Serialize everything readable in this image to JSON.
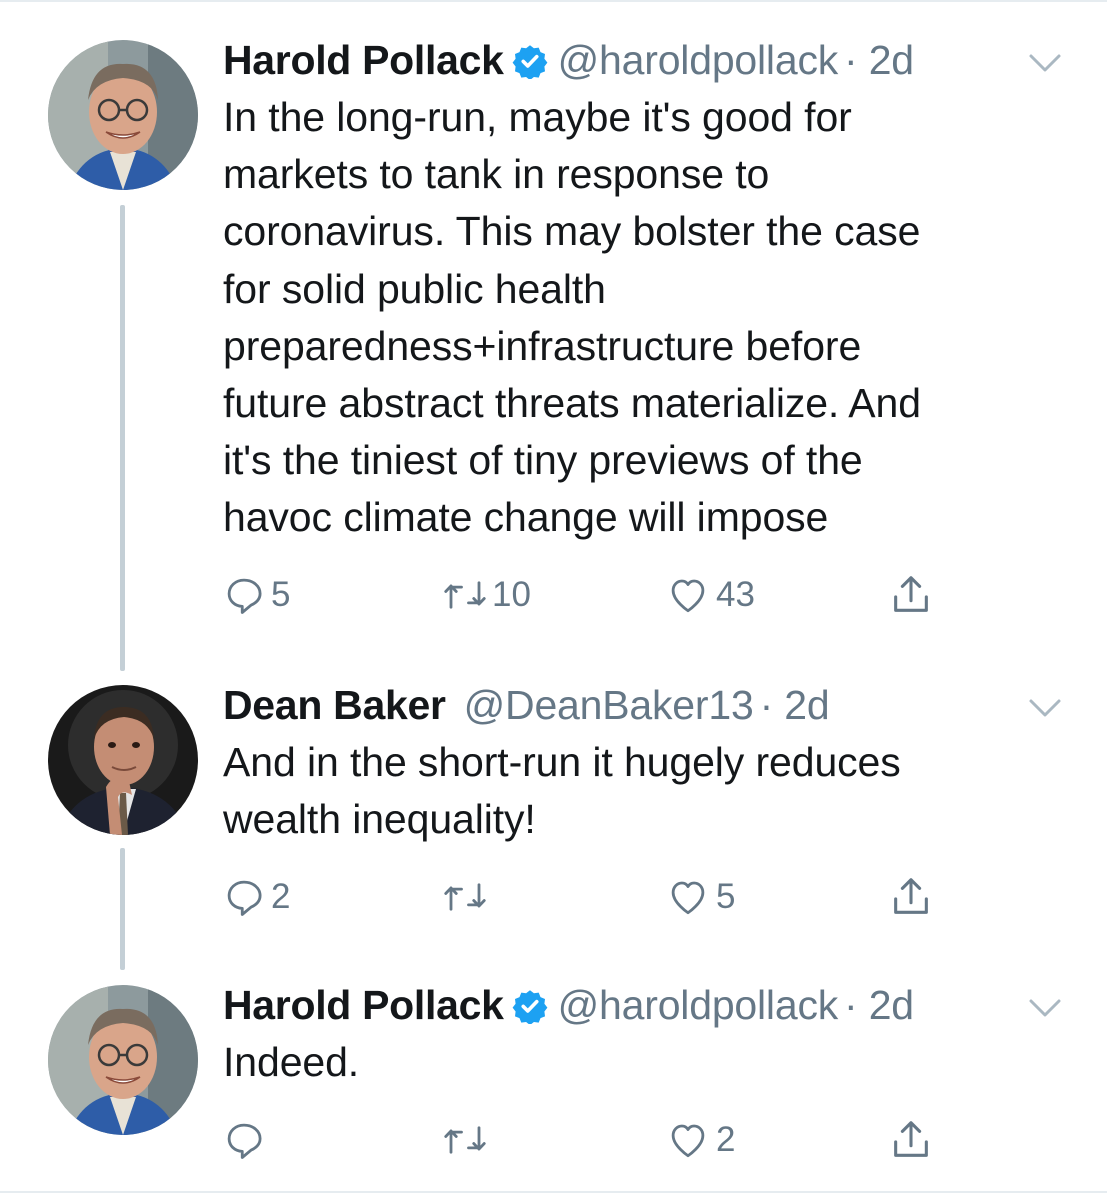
{
  "colors": {
    "verified": "#1da1f2",
    "icon_gray": "#657786",
    "thread_line": "#c4cfd6",
    "text": "#14171a"
  },
  "tweets": [
    {
      "author": "Harold Pollack",
      "verified": true,
      "handle": "@haroldpollack",
      "time": "· 2d",
      "text": "In the long-run, maybe it's good for\nmarkets to tank in response to\ncoronavirus. This may bolster the case\nfor solid public health\npreparedness+infrastructure before\nfuture abstract threats materialize. And\nit's the tiniest of tiny previews of the\nhavoc climate change will impose",
      "replies": "5",
      "retweets": "10",
      "likes": "43",
      "avatar_icon": "avatar-harold"
    },
    {
      "author": "Dean Baker",
      "verified": false,
      "handle": "@DeanBaker13",
      "time": "· 2d",
      "text": "And in the short-run it hugely reduces\nwealth inequality!",
      "replies": "2",
      "retweets": "",
      "likes": "5",
      "avatar_icon": "avatar-dean"
    },
    {
      "author": "Harold Pollack",
      "verified": true,
      "handle": "@haroldpollack",
      "time": "· 2d",
      "text": "Indeed.",
      "replies": "",
      "retweets": "",
      "likes": "2",
      "avatar_icon": "avatar-harold"
    }
  ],
  "icons": {
    "reply": "reply-icon",
    "retweet": "retweet-icon",
    "like": "heart-icon",
    "share": "share-icon",
    "caret": "chevron-down-icon",
    "verified": "verified-badge-icon"
  }
}
